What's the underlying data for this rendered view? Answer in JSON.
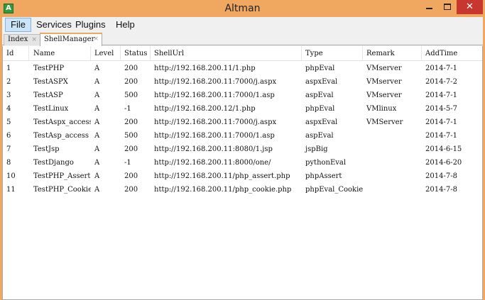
{
  "window": {
    "title": "Altman",
    "app_icon_letter": "A",
    "close_glyph": "✕"
  },
  "menu": {
    "file": "File",
    "services": "Services",
    "plugins": "Plugins",
    "help": "Help"
  },
  "tabs": [
    {
      "label": "Index",
      "close": "×"
    },
    {
      "label": "ShellManager",
      "close": "×"
    }
  ],
  "table": {
    "columns": [
      "Id",
      "Name",
      "Level",
      "Status",
      "ShellUrl",
      "Type",
      "Remark",
      "AddTime"
    ],
    "rows": [
      {
        "id": "1",
        "name": "TestPHP",
        "level": "A",
        "status": "200",
        "url": "http://192.168.200.11/1.php",
        "type": "phpEval",
        "remark": "VMserver",
        "time": "2014-7-1"
      },
      {
        "id": "2",
        "name": "TestASPX",
        "level": "A",
        "status": "200",
        "url": "http://192.168.200.11:7000/j.aspx",
        "type": "aspxEval",
        "remark": "VMserver",
        "time": "2014-7-2"
      },
      {
        "id": "3",
        "name": "TestASP",
        "level": "A",
        "status": "500",
        "url": "http://192.168.200.11:7000/1.asp",
        "type": "aspEval",
        "remark": "VMserver",
        "time": "2014-7-1"
      },
      {
        "id": "4",
        "name": "TestLinux",
        "level": "A",
        "status": "-1",
        "url": "http://192.168.200.12/1.php",
        "type": "phpEval",
        "remark": "VMlinux",
        "time": "2014-5-7"
      },
      {
        "id": "5",
        "name": "TestAspx_access",
        "level": "A",
        "status": "200",
        "url": "http://192.168.200.11:7000/j.aspx",
        "type": "aspxEval",
        "remark": "VMServer",
        "time": "2014-7-1"
      },
      {
        "id": "6",
        "name": "TestAsp_access",
        "level": "A",
        "status": "500",
        "url": "http://192.168.200.11:7000/1.asp",
        "type": "aspEval",
        "remark": "",
        "time": "2014-7-1"
      },
      {
        "id": "7",
        "name": "TestJsp",
        "level": "A",
        "status": "200",
        "url": "http://192.168.200.11:8080/1.jsp",
        "type": "jspBig",
        "remark": "",
        "time": "2014-6-15"
      },
      {
        "id": "8",
        "name": "TestDjango",
        "level": "A",
        "status": "-1",
        "url": "http://192.168.200.11:8000/one/",
        "type": "pythonEval",
        "remark": "",
        "time": "2014-6-20"
      },
      {
        "id": "10",
        "name": "TestPHP_Assert",
        "level": "A",
        "status": "200",
        "url": "http://192.168.200.11/php_assert.php",
        "type": "phpAssert",
        "remark": "",
        "time": "2014-7-8"
      },
      {
        "id": "11",
        "name": "TestPHP_Cookie",
        "level": "A",
        "status": "200",
        "url": "http://192.168.200.11/php_cookie.php",
        "type": "phpEval_Cookie",
        "remark": "",
        "time": "2014-7-8"
      }
    ]
  },
  "colors": {
    "title_bar": "#f0a860",
    "close_button": "#c7372f",
    "menu_active": "#cce4f7"
  }
}
